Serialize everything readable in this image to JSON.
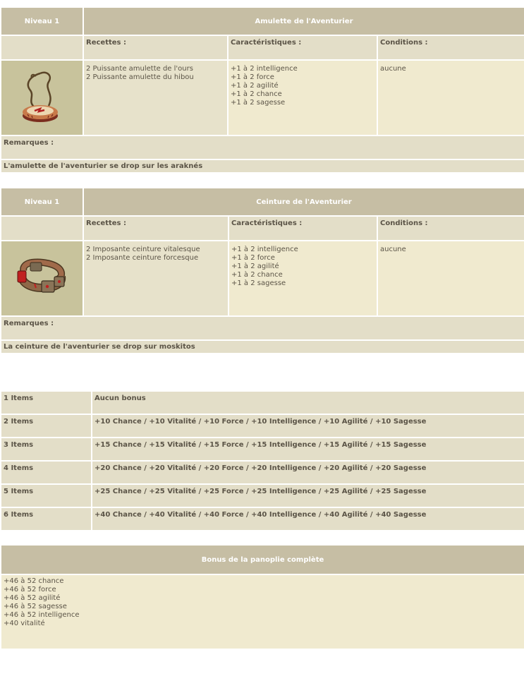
{
  "items": [
    {
      "level": "Niveau 1",
      "name": "Amulette de l'Aventurier",
      "icon": "amulet-icon",
      "recipes_label": "Recettes :",
      "stats_label": "Caractéristiques :",
      "conditions_label": "Conditions :",
      "recipes": [
        "2 Puissante amulette de l'ours",
        "2 Puissante amulette du hibou"
      ],
      "stats": [
        "+1 à 2 intelligence",
        "+1 à 2 force",
        "+1 à 2 agilité",
        "+1 à 2 chance",
        "+1 à 2 sagesse"
      ],
      "conditions": "aucune",
      "remarks_label": "Remarques :",
      "remarks": "L'amulette de l'aventurier se drop sur les araknés"
    },
    {
      "level": "Niveau 1",
      "name": "Ceinture de l'Aventurier",
      "icon": "belt-icon",
      "recipes_label": "Recettes :",
      "stats_label": "Caractéristiques :",
      "conditions_label": "Conditions :",
      "recipes": [
        "2 Imposante ceinture vitalesque",
        "2 Imposante ceinture forcesque"
      ],
      "stats": [
        "+1 à 2 intelligence",
        "+1 à 2 force",
        "+1 à 2 agilité",
        "+1 à 2 chance",
        "+1 à 2 sagesse"
      ],
      "conditions": "aucune",
      "remarks_label": "Remarques :",
      "remarks": "La ceinture de l'aventurier se drop sur moskitos"
    }
  ],
  "set_bonuses": [
    {
      "label": "1 Items",
      "value": "Aucun bonus"
    },
    {
      "label": "2 Items",
      "value": "+10 Chance / +10 Vitalité / +10 Force / +10 Intelligence / +10 Agilité / +10 Sagesse"
    },
    {
      "label": "3 Items",
      "value": "+15 Chance / +15 Vitalité / +15 Force / +15 Intelligence / +15 Agilité / +15 Sagesse"
    },
    {
      "label": "4 Items",
      "value": "+20 Chance / +20 Vitalité / +20 Force / +20 Intelligence / +20 Agilité / +20 Sagesse"
    },
    {
      "label": "5 Items",
      "value": "+25 Chance / +25 Vitalité / +25 Force / +25 Intelligence / +25 Agilité / +25 Sagesse"
    },
    {
      "label": "6 Items",
      "value": "+40 Chance / +40 Vitalité / +40 Force / +40 Intelligence / +40 Agilité / +40 Sagesse"
    }
  ],
  "full_set": {
    "title": "Bonus de la panoplie complète",
    "lines": [
      "+46 à 52 chance",
      "+46 à 52 force",
      "+46 à 52 agilité",
      "+46 à 52 sagesse",
      "+46 à 52 intelligence",
      "+40 vitalité"
    ]
  },
  "colors": {
    "header_bg": "#c6bea4",
    "subheader_bg": "#e3dec8",
    "cell_bg": "#f0eacf",
    "image_bg": "#c8c39c",
    "text": "#5b5447"
  }
}
